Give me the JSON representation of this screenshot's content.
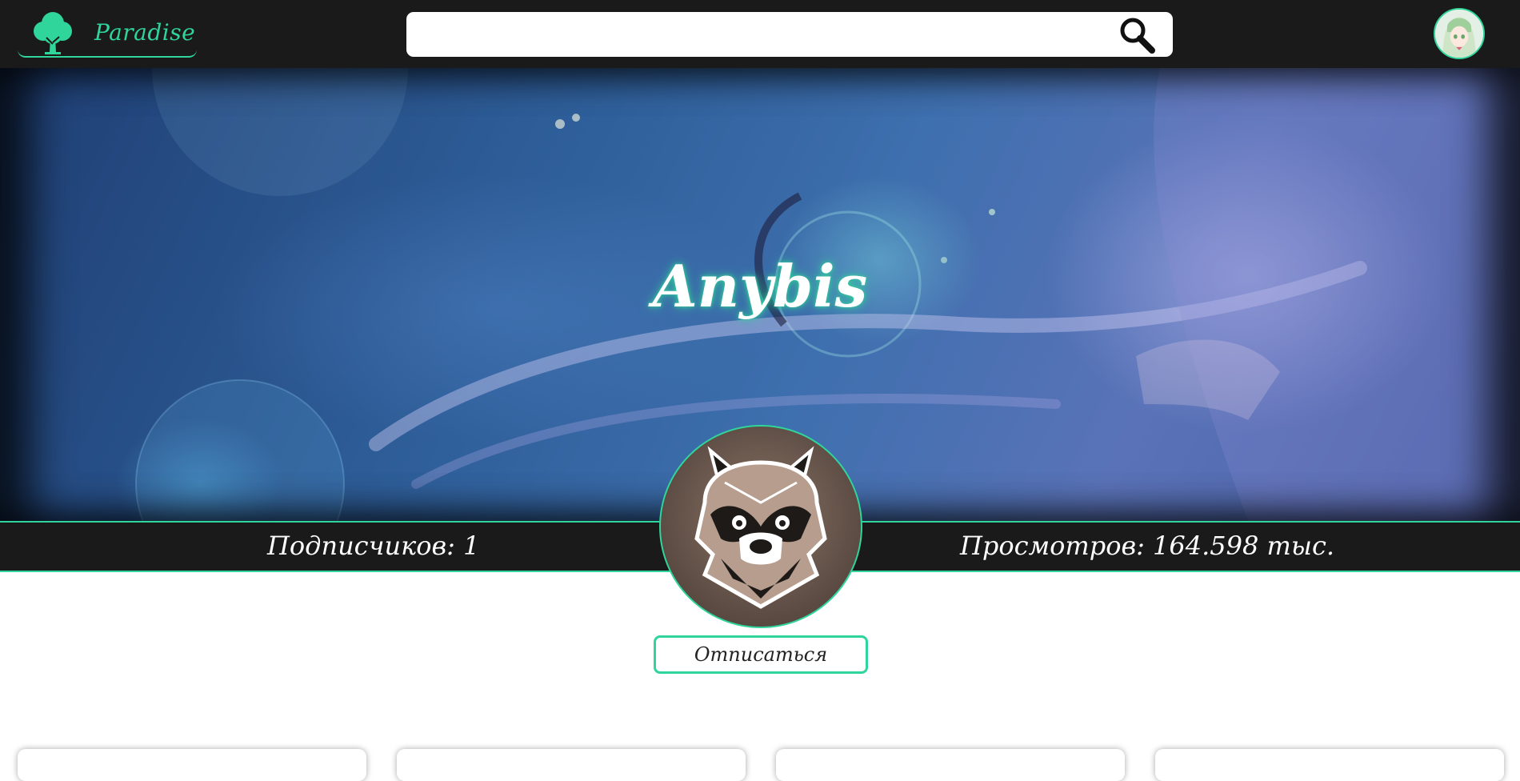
{
  "header": {
    "brand_name": "Paradise",
    "search": {
      "value": "",
      "placeholder": ""
    }
  },
  "channel": {
    "name": "Anybis",
    "subscribers_text": "Подписчиков: 1",
    "views_text": "Просмотров: 164.598 тыс.",
    "unsubscribe_label": "Отписаться"
  },
  "colors": {
    "accent": "#2fd59a",
    "bar_background": "#1a1a1a"
  },
  "icons": {
    "logo": "tree-icon",
    "search": "magnifier-icon",
    "channel_avatar": "raccoon-icon"
  }
}
